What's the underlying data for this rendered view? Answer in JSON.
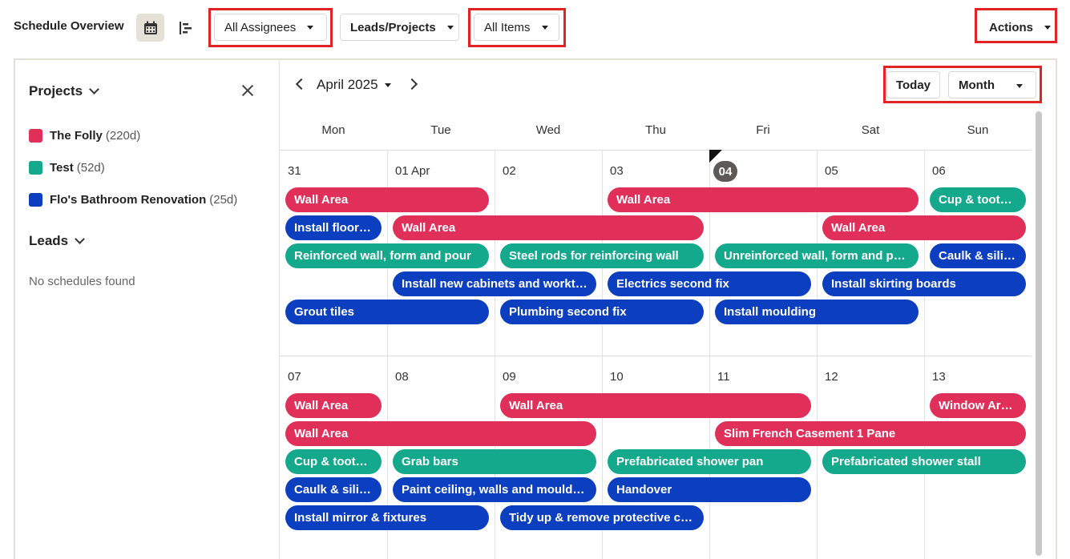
{
  "header": {
    "title": "Schedule Overview",
    "assignees_label": "All Assignees",
    "leads_projects_label": "Leads/Projects",
    "items_label": "All Items",
    "actions_label": "Actions"
  },
  "sidebar": {
    "projects_heading": "Projects",
    "projects": [
      {
        "name": "The Folly",
        "duration": "(220d)",
        "color": "#e0305a"
      },
      {
        "name": "Test",
        "duration": "(52d)",
        "color": "#14a88c"
      },
      {
        "name": "Flo's Bathroom Renovation",
        "duration": "(25d)",
        "color": "#0b3fbf"
      }
    ],
    "leads_heading": "Leads",
    "leads_empty": "No schedules found"
  },
  "calendar": {
    "month_label": "April 2025",
    "today_button": "Today",
    "view_select": "Month",
    "weekdays": [
      "Mon",
      "Tue",
      "Wed",
      "Thu",
      "Fri",
      "Sat",
      "Sun"
    ],
    "weeks": [
      [
        "31",
        "01 Apr",
        "02",
        "03",
        "04",
        "05",
        "06"
      ],
      [
        "07",
        "08",
        "09",
        "10",
        "11",
        "12",
        "13"
      ]
    ],
    "today_index": [
      0,
      4
    ]
  },
  "colors": {
    "red": "#e0305a",
    "teal": "#14a88c",
    "blue": "#0b3fbf",
    "highlight": "#e02424"
  },
  "events": [
    {
      "label": "Wall Area",
      "color": "red",
      "week": 0,
      "start": 0,
      "span": 2,
      "row": 0
    },
    {
      "label": "Wall Area",
      "color": "red",
      "week": 0,
      "start": 3,
      "span": 3,
      "row": 0
    },
    {
      "label": "Cup & toothb...",
      "color": "teal",
      "week": 0,
      "start": 6,
      "span": 1,
      "row": 0
    },
    {
      "label": "Install floor a...",
      "color": "blue",
      "week": 0,
      "start": 0,
      "span": 1,
      "row": 1
    },
    {
      "label": "Wall Area",
      "color": "red",
      "week": 0,
      "start": 1,
      "span": 3,
      "row": 1
    },
    {
      "label": "Wall Area",
      "color": "red",
      "week": 0,
      "start": 5,
      "span": 2,
      "row": 1
    },
    {
      "label": "Reinforced wall, form and pour",
      "color": "teal",
      "week": 0,
      "start": 0,
      "span": 2,
      "row": 2
    },
    {
      "label": "Steel rods for reinforcing wall",
      "color": "teal",
      "week": 0,
      "start": 2,
      "span": 2,
      "row": 2
    },
    {
      "label": "Unreinforced wall, form and pour",
      "color": "teal",
      "week": 0,
      "start": 4,
      "span": 2,
      "row": 2
    },
    {
      "label": "Caulk & silico...",
      "color": "blue",
      "week": 0,
      "start": 6,
      "span": 1,
      "row": 2
    },
    {
      "label": "Install new cabinets and worktops",
      "color": "blue",
      "week": 0,
      "start": 1,
      "span": 2,
      "row": 3
    },
    {
      "label": "Electrics second fix",
      "color": "blue",
      "week": 0,
      "start": 3,
      "span": 2,
      "row": 3
    },
    {
      "label": "Install skirting boards",
      "color": "blue",
      "week": 0,
      "start": 5,
      "span": 2,
      "row": 3
    },
    {
      "label": "Grout tiles",
      "color": "blue",
      "week": 0,
      "start": 0,
      "span": 2,
      "row": 4
    },
    {
      "label": "Plumbing second fix",
      "color": "blue",
      "week": 0,
      "start": 2,
      "span": 2,
      "row": 4
    },
    {
      "label": "Install moulding",
      "color": "blue",
      "week": 0,
      "start": 4,
      "span": 2,
      "row": 4
    },
    {
      "label": "Wall Area",
      "color": "red",
      "week": 1,
      "start": 0,
      "span": 1,
      "row": 0
    },
    {
      "label": "Wall Area",
      "color": "red",
      "week": 1,
      "start": 2,
      "span": 3,
      "row": 0
    },
    {
      "label": "Window Arch...",
      "color": "red",
      "week": 1,
      "start": 6,
      "span": 1,
      "row": 0
    },
    {
      "label": "Wall Area",
      "color": "red",
      "week": 1,
      "start": 0,
      "span": 3,
      "row": 1
    },
    {
      "label": "Slim French Casement 1 Pane",
      "color": "red",
      "week": 1,
      "start": 4,
      "span": 3,
      "row": 1
    },
    {
      "label": "Cup & toothb...",
      "color": "teal",
      "week": 1,
      "start": 0,
      "span": 1,
      "row": 2
    },
    {
      "label": "Grab bars",
      "color": "teal",
      "week": 1,
      "start": 1,
      "span": 2,
      "row": 2
    },
    {
      "label": "Prefabricated shower pan",
      "color": "teal",
      "week": 1,
      "start": 3,
      "span": 2,
      "row": 2
    },
    {
      "label": "Prefabricated shower stall",
      "color": "teal",
      "week": 1,
      "start": 5,
      "span": 2,
      "row": 2
    },
    {
      "label": "Caulk & silico...",
      "color": "blue",
      "week": 1,
      "start": 0,
      "span": 1,
      "row": 3
    },
    {
      "label": "Paint ceiling, walls and moulding",
      "color": "blue",
      "week": 1,
      "start": 1,
      "span": 2,
      "row": 3
    },
    {
      "label": "Handover",
      "color": "blue",
      "week": 1,
      "start": 3,
      "span": 2,
      "row": 3
    },
    {
      "label": "Install mirror & fixtures",
      "color": "blue",
      "week": 1,
      "start": 0,
      "span": 2,
      "row": 4
    },
    {
      "label": "Tidy up & remove protective cov...",
      "color": "blue",
      "week": 1,
      "start": 2,
      "span": 2,
      "row": 4
    }
  ]
}
